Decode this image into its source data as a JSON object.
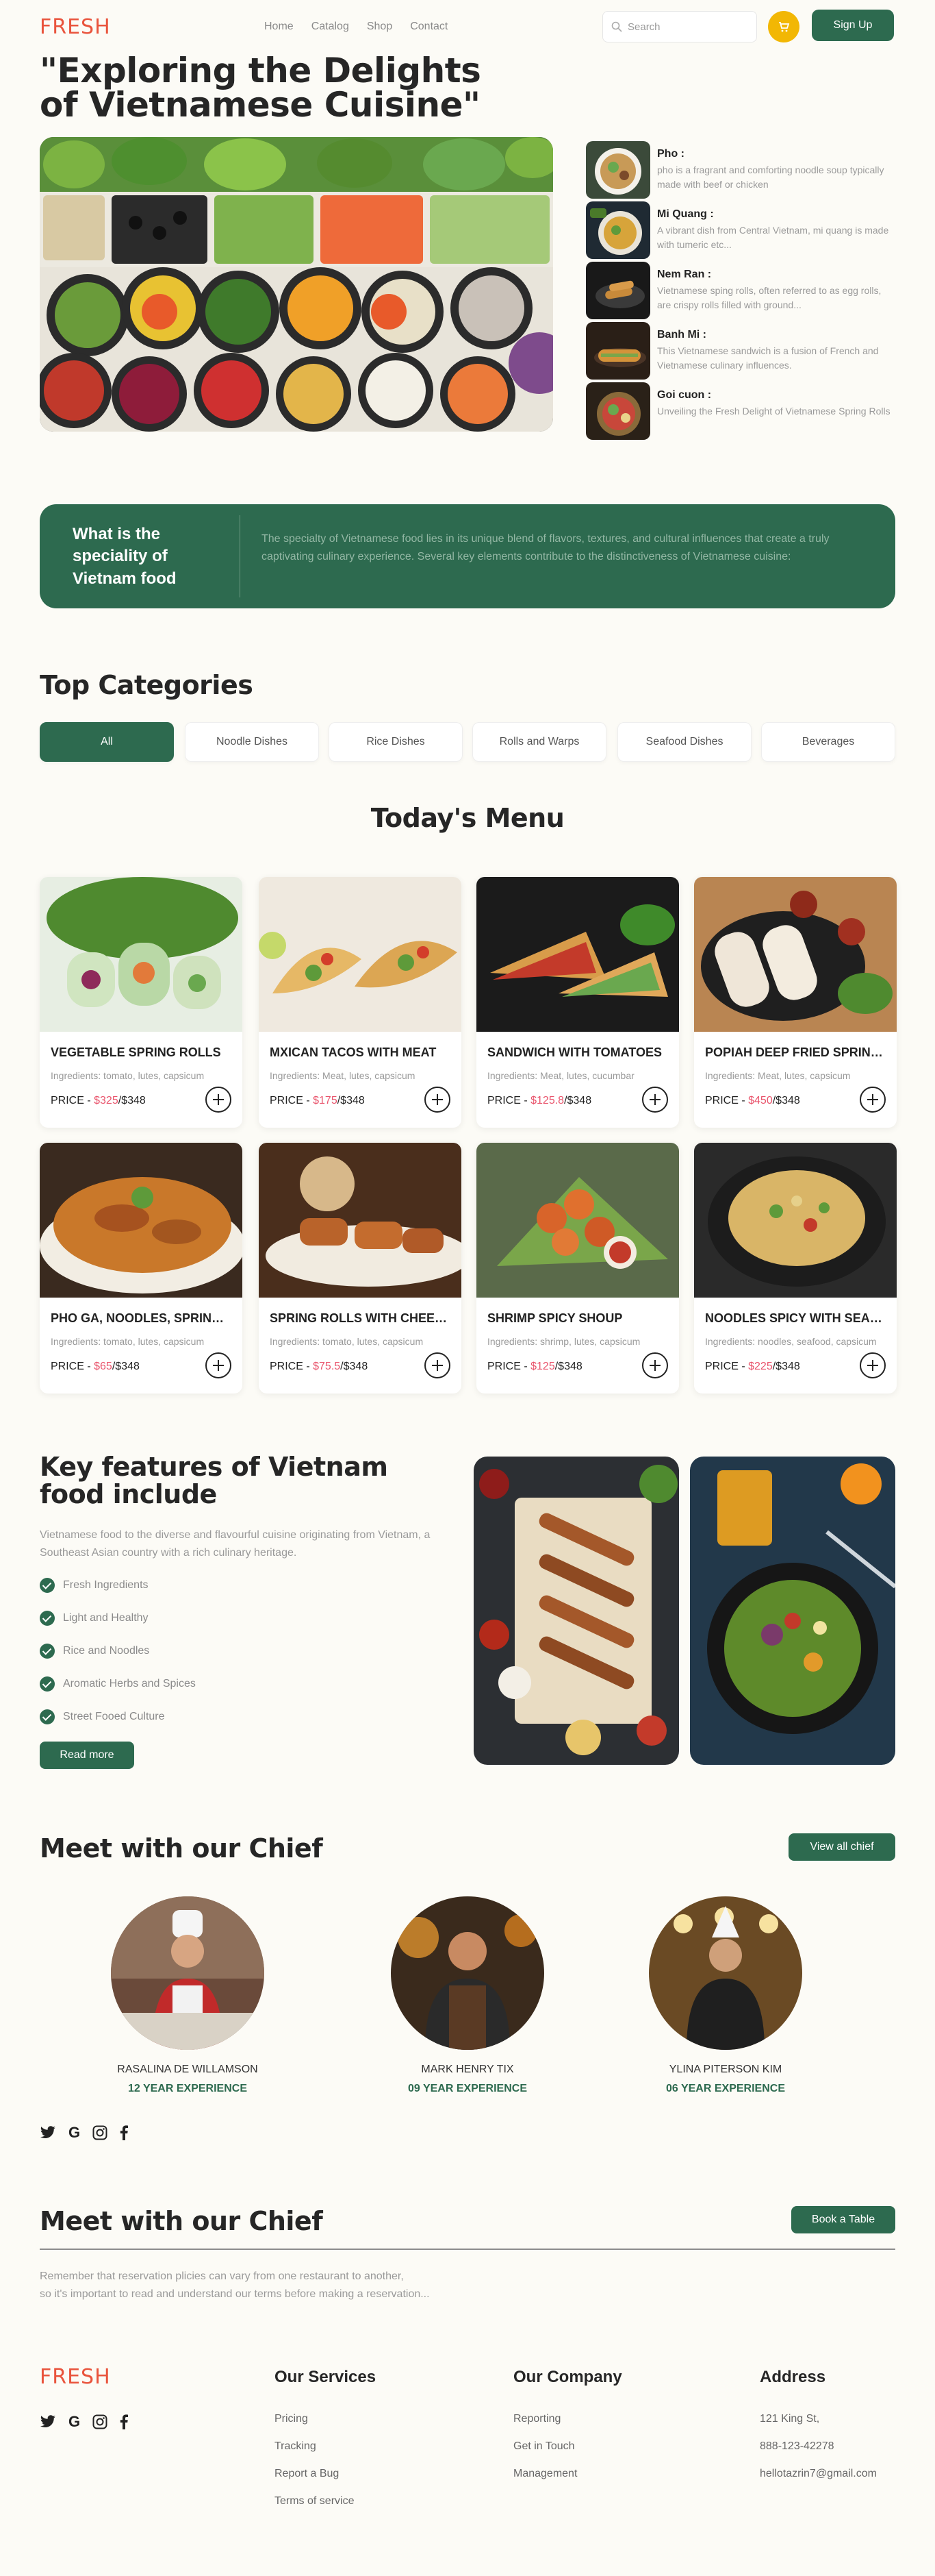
{
  "header": {
    "logo": "FRESH",
    "nav": [
      "Home",
      "Catalog",
      "Shop",
      "Contact"
    ],
    "search_placeholder": "Search",
    "signup_label": "Sign Up"
  },
  "hero": {
    "title": "\"Exploring the Delights of Vietnamese Cuisine\"",
    "dishes": [
      {
        "name": "Pho :",
        "desc": "pho is a fragrant and comforting noodle soup typically made with beef or chicken"
      },
      {
        "name": "Mi Quang :",
        "desc": "A vibrant dish from Central Vietnam, mi quang is made with tumeric etc..."
      },
      {
        "name": "Nem Ran :",
        "desc": "Vietnamese sping rolls, often referred to as egg rolls, are crispy rolls filled with ground..."
      },
      {
        "name": "Banh Mi :",
        "desc": "This Vietnamese sandwich is a fusion of French and Vietnamese culinary influences."
      },
      {
        "name": "Goi cuon :",
        "desc": "Unveiling the Fresh Delight of Vietnamese Spring Rolls"
      }
    ]
  },
  "banner": {
    "title": "What is the speciality of Vietnam food",
    "text": "The specialty of Vietnamese food lies in its unique blend of flavors, textures, and cultural influences that create a truly captivating culinary experience. Several key elements contribute to the distinctiveness of Vietnamese cuisine:"
  },
  "categories": {
    "title": "Top Categories",
    "items": [
      "All",
      "Noodle Dishes",
      "Rice Dishes",
      "Rolls and Warps",
      "Seafood Dishes",
      "Beverages"
    ]
  },
  "menu": {
    "title": "Today's Menu",
    "price_label": "PRICE - ",
    "items": [
      {
        "name": "VEGETABLE SPRING ROLLS",
        "ingredients": "Ingredients: tomato, lutes, capsicum",
        "old": "$325",
        "new": "/$348"
      },
      {
        "name": "MXICAN TACOS WITH MEAT",
        "ingredients": "Ingredients: Meat, lutes, capsicum",
        "old": "$175",
        "new": "/$348"
      },
      {
        "name": "SANDWICH WITH TOMATOES",
        "ingredients": "Ingredients: Meat, lutes, cucumbar",
        "old": "$125.8",
        "new": "/$348"
      },
      {
        "name": "POPIAH DEEP FRIED SPRING ROLLS",
        "ingredients": "Ingredients: Meat, lutes, capsicum",
        "old": "$450",
        "new": "/$348"
      },
      {
        "name": "PHO GA, NOODLES, SPRING ROLLS",
        "ingredients": "Ingredients: tomato, lutes, capsicum",
        "old": "$65",
        "new": "/$348"
      },
      {
        "name": "SPRING ROLLS WITH CHEESE",
        "ingredients": "Ingredients: tomato, lutes, capsicum",
        "old": "$75.5",
        "new": "/$348"
      },
      {
        "name": "SHRIMP SPICY SHOUP",
        "ingredients": "Ingredients: shrimp, lutes, capsicum",
        "old": "$125",
        "new": "/$348"
      },
      {
        "name": "NOODLES SPICY WITH SEAFOOD",
        "ingredients": "Ingredients: noodles, seafood, capsicum",
        "old": "$225",
        "new": "/$348"
      }
    ]
  },
  "features": {
    "title": "Key features of Vietnam food include",
    "text": "Vietnamese food to the diverse and flavourful cuisine originating from Vietnam, a Southeast Asian country with a rich culinary heritage.",
    "items": [
      "Fresh Ingredients",
      "Light and Healthy",
      "Rice and Noodles",
      "Aromatic Herbs and Spices",
      "Street Fooed Culture"
    ],
    "read_more": "Read more"
  },
  "chefs": {
    "title": "Meet with our Chief",
    "view_all": "View all chief",
    "items": [
      {
        "name": "RASALINA DE WILLAMSON",
        "exp": "12 YEAR EXPERIENCE"
      },
      {
        "name": "MARK HENRY TIX",
        "exp": "09 YEAR EXPERIENCE"
      },
      {
        "name": "YLINA PITERSON KIM",
        "exp": "06 YEAR EXPERIENCE"
      }
    ]
  },
  "social": [
    "twitter",
    "google",
    "instagram",
    "facebook"
  ],
  "reserve": {
    "title": "Meet with our Chief",
    "button": "Book a Table",
    "text1": "Remember that reservation plicies can vary from one restaurant to another,",
    "text2": "so it's important to read and understand our terms before making a reservation..."
  },
  "footer": {
    "logo": "FRESH",
    "services_title": "Our Services",
    "services": [
      "Pricing",
      "Tracking",
      "Report a Bug",
      "Terms of service"
    ],
    "company_title": "Our Company",
    "company": [
      "Reporting",
      "Get in Touch",
      "Management"
    ],
    "address_title": "Address",
    "address": [
      "121 King St,",
      "888-123-42278",
      "hellotazrin7@gmail.com"
    ]
  },
  "colors": {
    "brand": "#e9543d",
    "primary": "#2d6a4f",
    "accent": "#f2b704",
    "price": "#e9546c"
  }
}
